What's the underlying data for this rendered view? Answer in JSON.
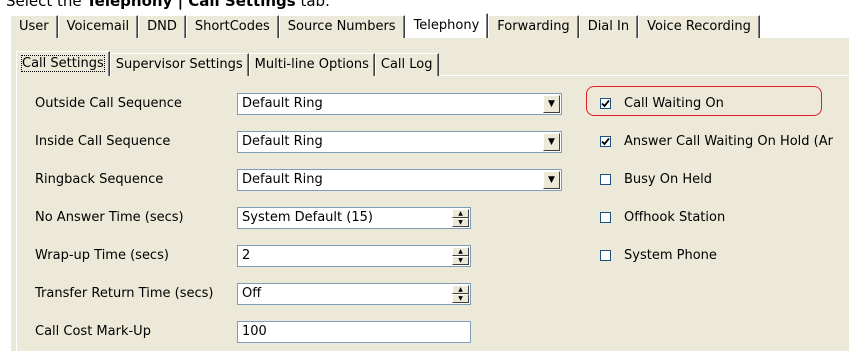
{
  "instruction": {
    "prefix": "Select the ",
    "bold": "Telephony | Call Settings",
    "suffix": " tab."
  },
  "tabs": [
    "User",
    "Voicemail",
    "DND",
    "ShortCodes",
    "Source Numbers",
    "Telephony",
    "Forwarding",
    "Dial In",
    "Voice Recording"
  ],
  "active_tab": "Telephony",
  "subtabs": [
    "Call Settings",
    "Supervisor Settings",
    "Multi-line Options",
    "Call Log"
  ],
  "active_subtab": "Call Settings",
  "fields": {
    "outside_call_sequence": {
      "label": "Outside Call Sequence",
      "value": "Default Ring"
    },
    "inside_call_sequence": {
      "label": "Inside Call Sequence",
      "value": "Default Ring"
    },
    "ringback_sequence": {
      "label": "Ringback Sequence",
      "value": "Default Ring"
    },
    "no_answer_time": {
      "label": "No Answer Time (secs)",
      "value": "System Default (15)"
    },
    "wrap_up_time": {
      "label": "Wrap-up Time (secs)",
      "value": "2"
    },
    "transfer_return_time": {
      "label": "Transfer Return Time (secs)",
      "value": "Off"
    },
    "call_cost_markup": {
      "label": "Call Cost Mark-Up",
      "value": "100"
    }
  },
  "checkboxes": [
    {
      "label": "Call Waiting On",
      "checked": true
    },
    {
      "label": "Answer Call Waiting On Hold (Ar",
      "checked": true
    },
    {
      "label": "Busy On Held",
      "checked": false
    },
    {
      "label": "Offhook Station",
      "checked": false
    },
    {
      "label": "System Phone",
      "checked": false
    }
  ],
  "colors": {
    "highlight": "#e02020",
    "panel": "#ece9d8"
  }
}
